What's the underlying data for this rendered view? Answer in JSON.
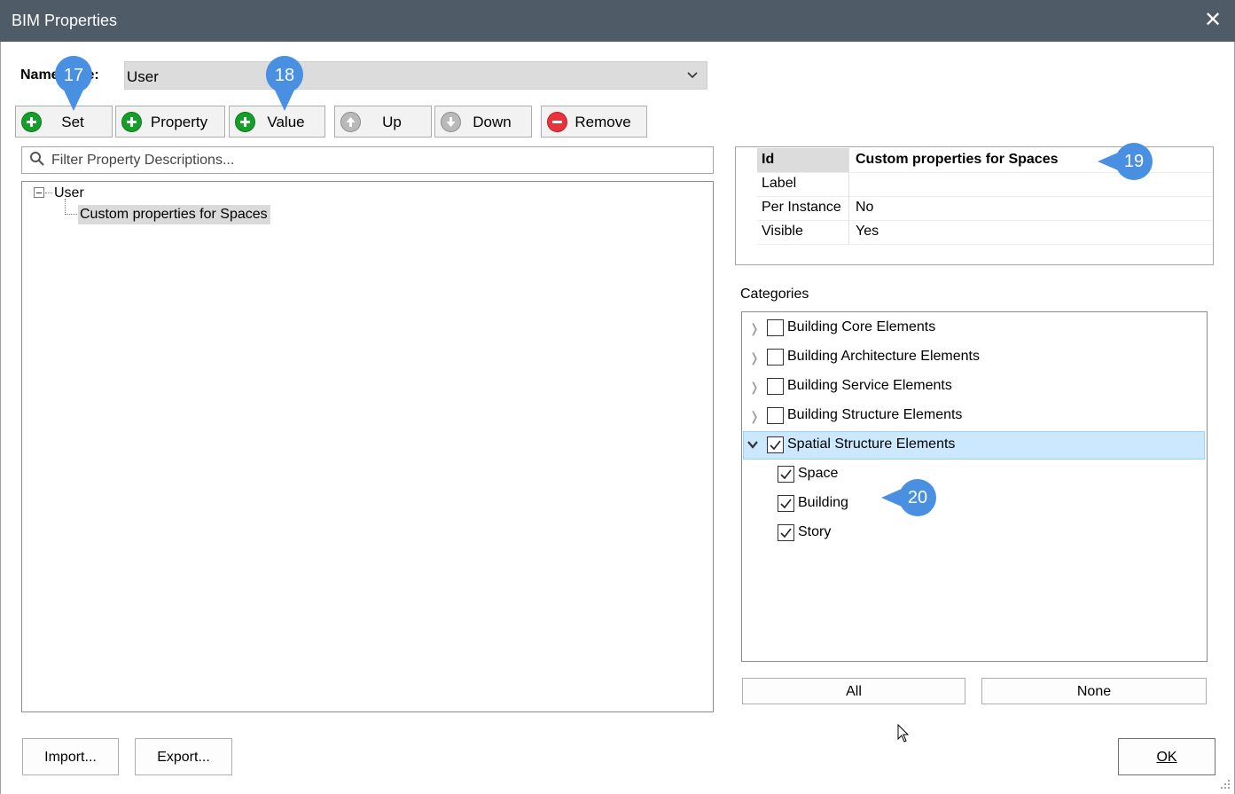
{
  "window": {
    "title": "BIM Properties",
    "close_glyph": "✕"
  },
  "namespace": {
    "label": "Name",
    "label_suffix": "ce:",
    "value": "User"
  },
  "toolbar": {
    "set": "Set",
    "property": "Property",
    "value": "Value",
    "up": "Up",
    "down": "Down",
    "remove": "Remove"
  },
  "filter": {
    "placeholder": "Filter Property Descriptions..."
  },
  "tree": {
    "root": "User",
    "child": "Custom properties for Spaces"
  },
  "properties": [
    {
      "key": "Id",
      "value": "Custom properties for Spaces"
    },
    {
      "key": "Label",
      "value": ""
    },
    {
      "key": "Per Instance",
      "value": "No"
    },
    {
      "key": "Visible",
      "value": "Yes"
    }
  ],
  "categories": {
    "label": "Categories",
    "items": [
      {
        "label": "Building Core Elements",
        "checked": false,
        "expanded": false
      },
      {
        "label": "Building Architecture Elements",
        "checked": false,
        "expanded": false
      },
      {
        "label": "Building Service Elements",
        "checked": false,
        "expanded": false
      },
      {
        "label": "Building Structure Elements",
        "checked": false,
        "expanded": false
      },
      {
        "label": "Spatial Structure Elements",
        "checked": true,
        "expanded": true
      }
    ],
    "children": [
      {
        "label": "Space",
        "checked": true
      },
      {
        "label": "Building",
        "checked": true
      },
      {
        "label": "Story",
        "checked": true
      }
    ],
    "all": "All",
    "none": "None"
  },
  "footer": {
    "import": "Import...",
    "export": "Export...",
    "ok": "OK"
  },
  "annotations": {
    "a17": "17",
    "a18": "18",
    "a19": "19",
    "a20": "20"
  },
  "colors": {
    "titlebar": "#4f5b66",
    "marker": "#4a90e2",
    "selection": "#cce8ff"
  }
}
